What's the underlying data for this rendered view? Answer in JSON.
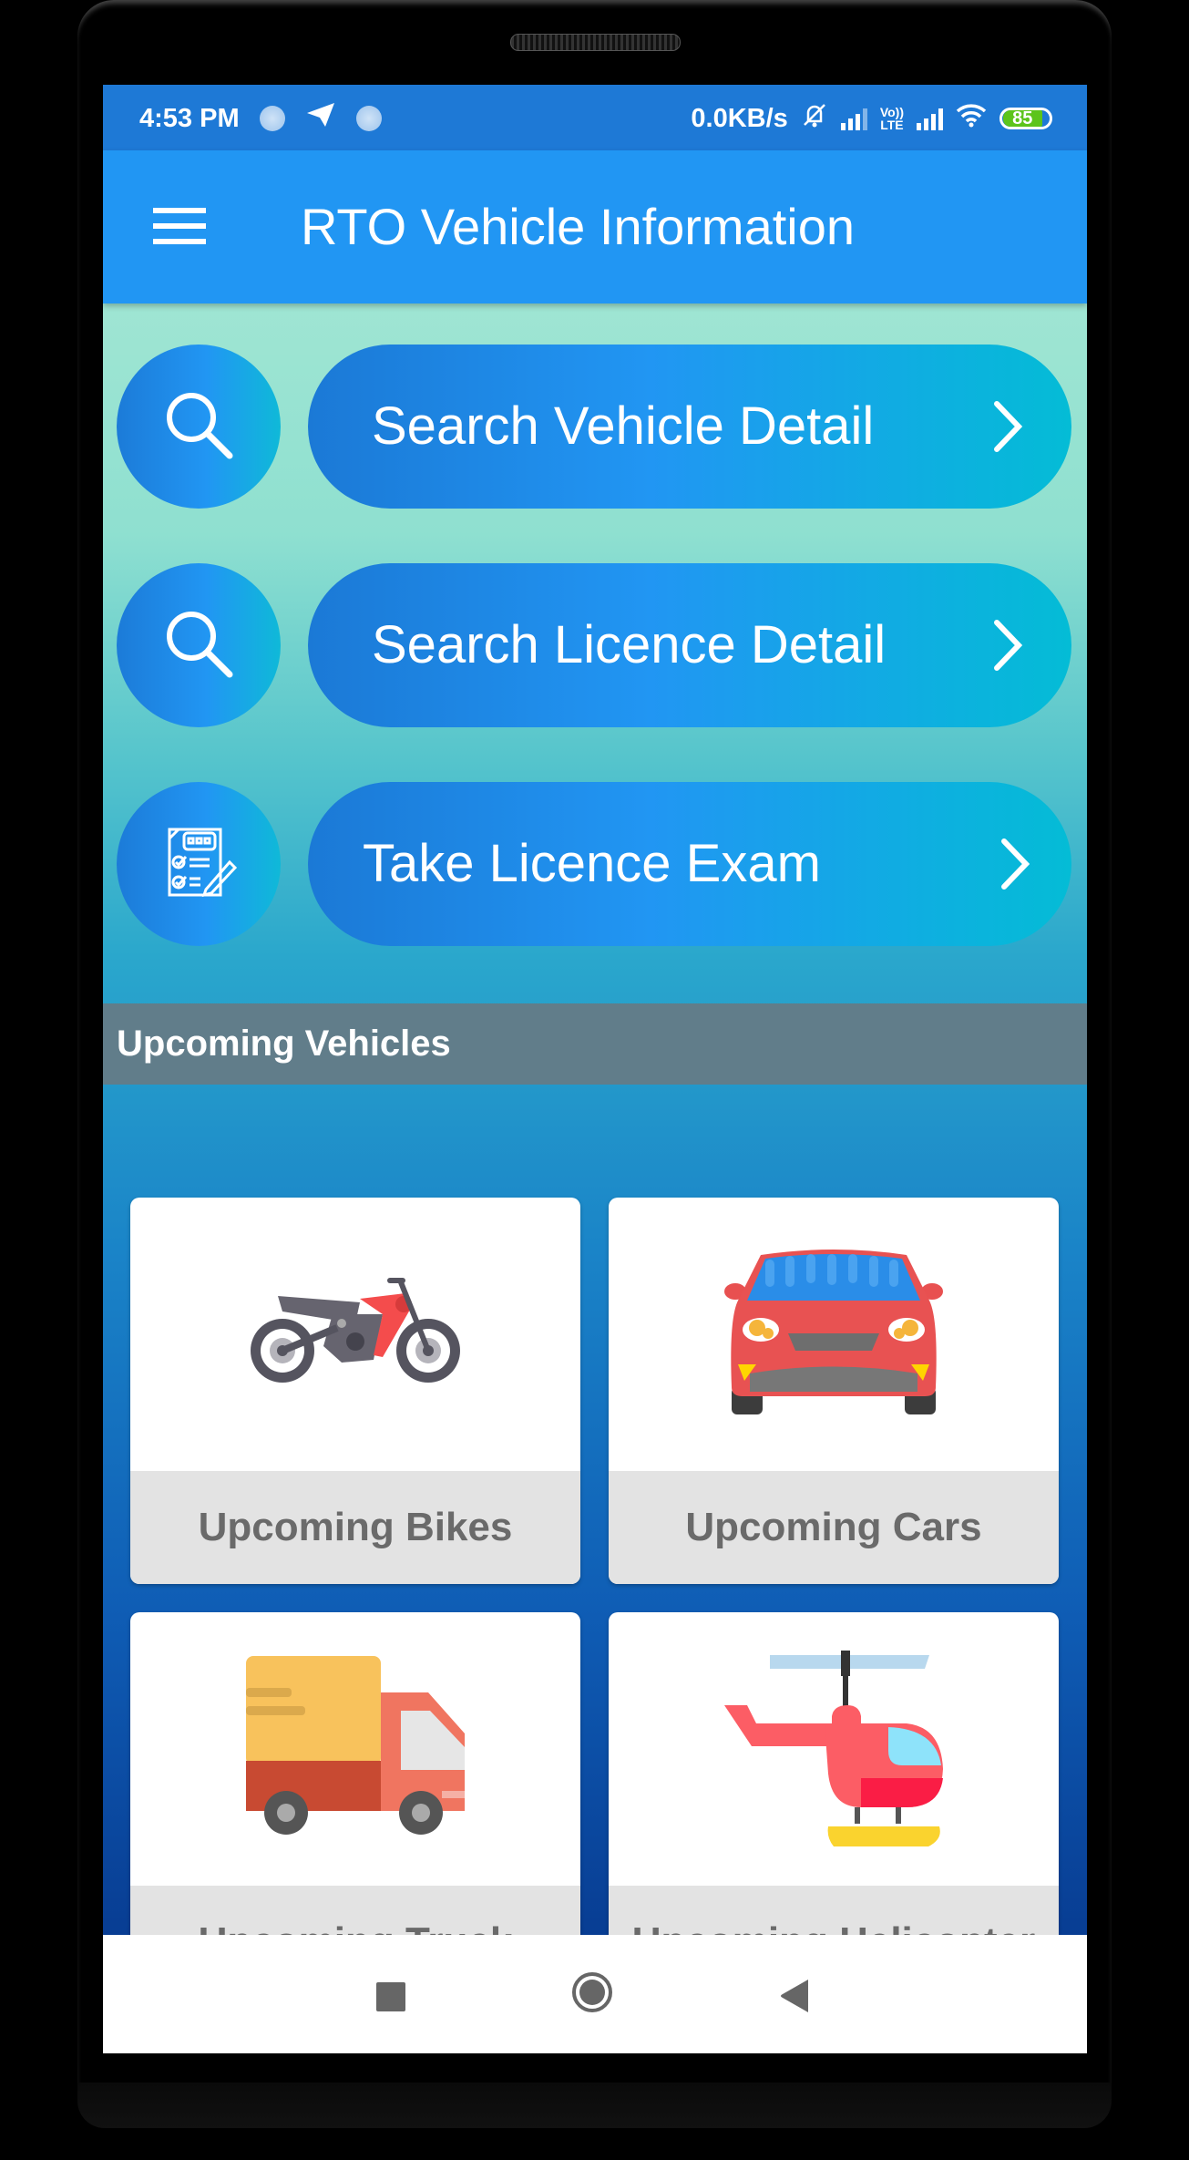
{
  "status_bar": {
    "time": "4:53 PM",
    "network_speed": "0.0KB/s",
    "network_type": [
      "Vo))",
      "LTE"
    ],
    "battery_level": "85",
    "icons": [
      "notification-dot-icon",
      "telegram-icon",
      "notification-dot-icon",
      "mute-bell-icon",
      "signal-icon",
      "volte-icon",
      "signal-icon",
      "wifi-icon",
      "battery-icon"
    ]
  },
  "app_bar": {
    "title": "RTO Vehicle Information",
    "menu_icon": "hamburger-menu-icon"
  },
  "actions": [
    {
      "label": "Search Vehicle Detail",
      "icon": "search-icon"
    },
    {
      "label": "Search Licence Detail",
      "icon": "search-icon"
    },
    {
      "label": "Take Licence Exam",
      "icon": "exam-checklist-icon"
    }
  ],
  "upcoming": {
    "header": "Upcoming Vehicles",
    "cards": [
      {
        "label": "Upcoming Bikes",
        "icon": "motorcycle-icon"
      },
      {
        "label": "Upcoming Cars",
        "icon": "car-icon"
      },
      {
        "label": "Upcoming Truck",
        "icon": "truck-icon"
      },
      {
        "label": "Upcoming Helicopter",
        "icon": "helicopter-icon"
      }
    ]
  },
  "nav_bar": {
    "buttons": [
      "recents-button",
      "home-button",
      "back-button"
    ]
  },
  "colors": {
    "status_bar": "#1e79d6",
    "app_bar": "#2196f3",
    "section_header": "#617d8a",
    "card_label_bg": "#e3e3e3",
    "card_label_text": "#6a6a6a"
  }
}
